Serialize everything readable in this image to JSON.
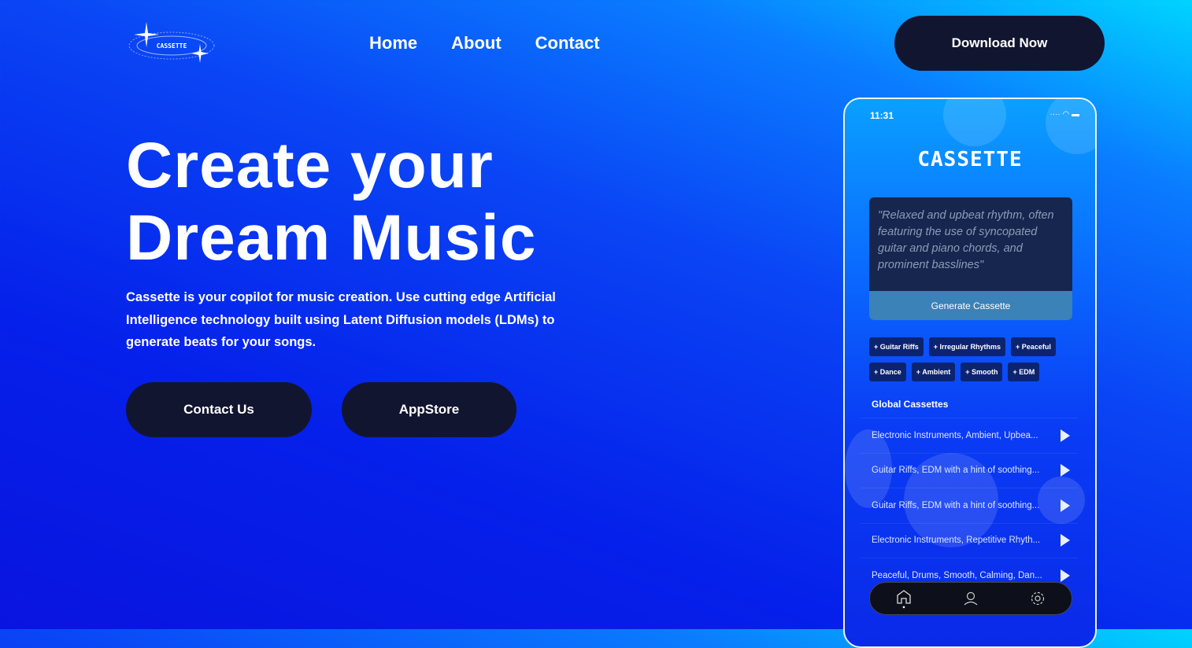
{
  "logo": {
    "text": "CASSETTE"
  },
  "nav": {
    "items": [
      "Home",
      "About",
      "Contact"
    ],
    "download": "Download Now"
  },
  "hero": {
    "title_line1": "Create your",
    "title_line2": "Dream Music",
    "description": "Cassette is your copilot for music creation. Use cutting edge Artificial Intelligence technology built using Latent Diffusion models (LDMs) to generate beats for your songs.",
    "contact": "Contact Us",
    "appstore": "AppStore"
  },
  "phone": {
    "time": "11:31",
    "logo": "CASSETTE",
    "prompt": "\"Relaxed and upbeat rhythm, often featuring the use of syncopated guitar and piano chords, and prominent basslines\"",
    "generate": "Generate Cassette",
    "tags": [
      "+ Guitar Riffs",
      "+ Irregular Rhythms",
      "+ Peaceful",
      "+ Dance",
      "+ Ambient",
      "+ Smooth",
      "+ EDM"
    ],
    "global_title": "Global Cassettes",
    "cassettes": [
      "Electronic Instruments, Ambient, Upbea...",
      "Guitar Riffs, EDM with a hint of soothing...",
      "Guitar Riffs, EDM with a hint of soothing...",
      "Electronic Instruments, Repetitive Rhyth...",
      "Peaceful, Drums, Smooth, Calming, Dan..."
    ],
    "tabs": [
      "home-icon",
      "profile-icon",
      "settings-icon"
    ]
  }
}
